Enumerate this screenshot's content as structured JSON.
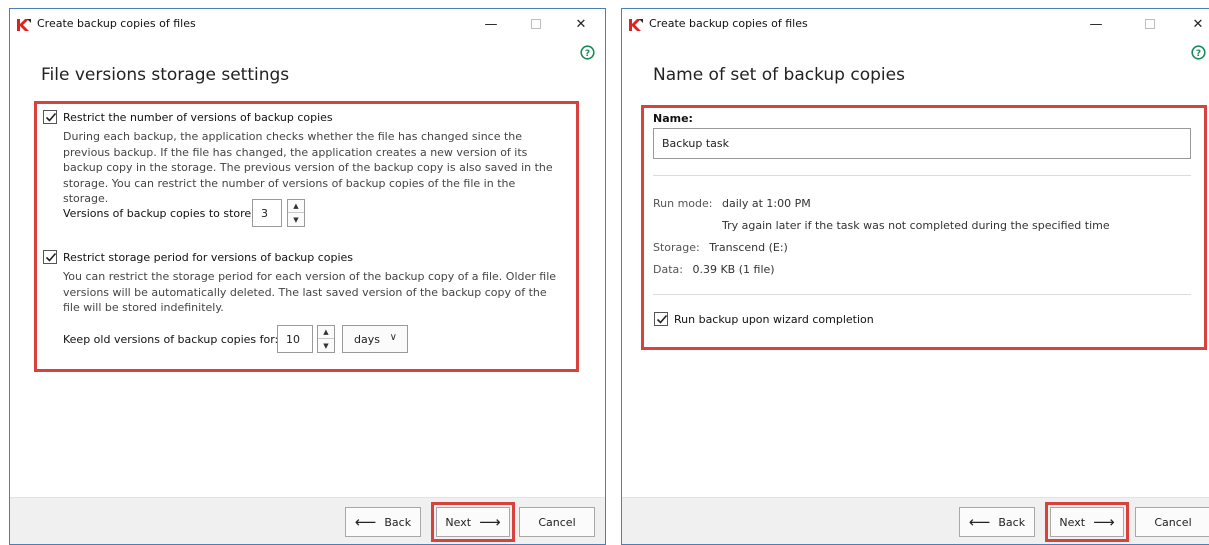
{
  "left": {
    "window_title": "Create backup copies of files",
    "heading": "File versions storage settings",
    "restrict_versions": {
      "checked": true,
      "label": "Restrict the number of versions of backup copies",
      "description": "During each backup, the application checks whether the file has changed since the previous backup. If the file has changed, the application creates a new version of its backup copy in the storage. The previous version of the backup copy is also saved in the storage. You can restrict the number of versions of backup copies of the file in the storage.",
      "field_label": "Versions of backup copies to store:",
      "field_value": "3"
    },
    "restrict_period": {
      "checked": true,
      "label": "Restrict storage period for versions of backup copies",
      "description": "You can restrict the storage period for each version of the backup copy of a file. Older file versions will be automatically deleted. The last saved version of the backup copy of the file will be stored indefinitely.",
      "field_label": "Keep old versions of backup copies for:",
      "field_value": "10",
      "unit": "days"
    },
    "buttons": {
      "back": "Back",
      "next": "Next",
      "cancel": "Cancel"
    }
  },
  "right": {
    "window_title": "Create backup copies of files",
    "heading": "Name of set of backup copies",
    "name_label": "Name:",
    "name_value": "Backup task",
    "run_mode_label": "Run mode:",
    "run_mode_value": "daily at 1:00 PM",
    "retry_note": "Try again later if the task was not completed during the specified time",
    "storage_label": "Storage:",
    "storage_value": "Transcend (E:)",
    "data_label": "Data:",
    "data_value": "0.39 KB (1 file)",
    "run_on_complete": {
      "checked": true,
      "label": "Run backup upon wizard completion"
    },
    "buttons": {
      "back": "Back",
      "next": "Next",
      "cancel": "Cancel"
    }
  },
  "icons": {
    "app": "kaspersky-k-icon",
    "help": "help-question-icon",
    "back_arrow": "arrow-left-icon",
    "next_arrow": "arrow-right-icon"
  },
  "colors": {
    "highlight": "#d9423c",
    "window_border": "#4a7fb8",
    "help_green": "#1a8a5a",
    "app_icon_red": "#e0221c"
  }
}
